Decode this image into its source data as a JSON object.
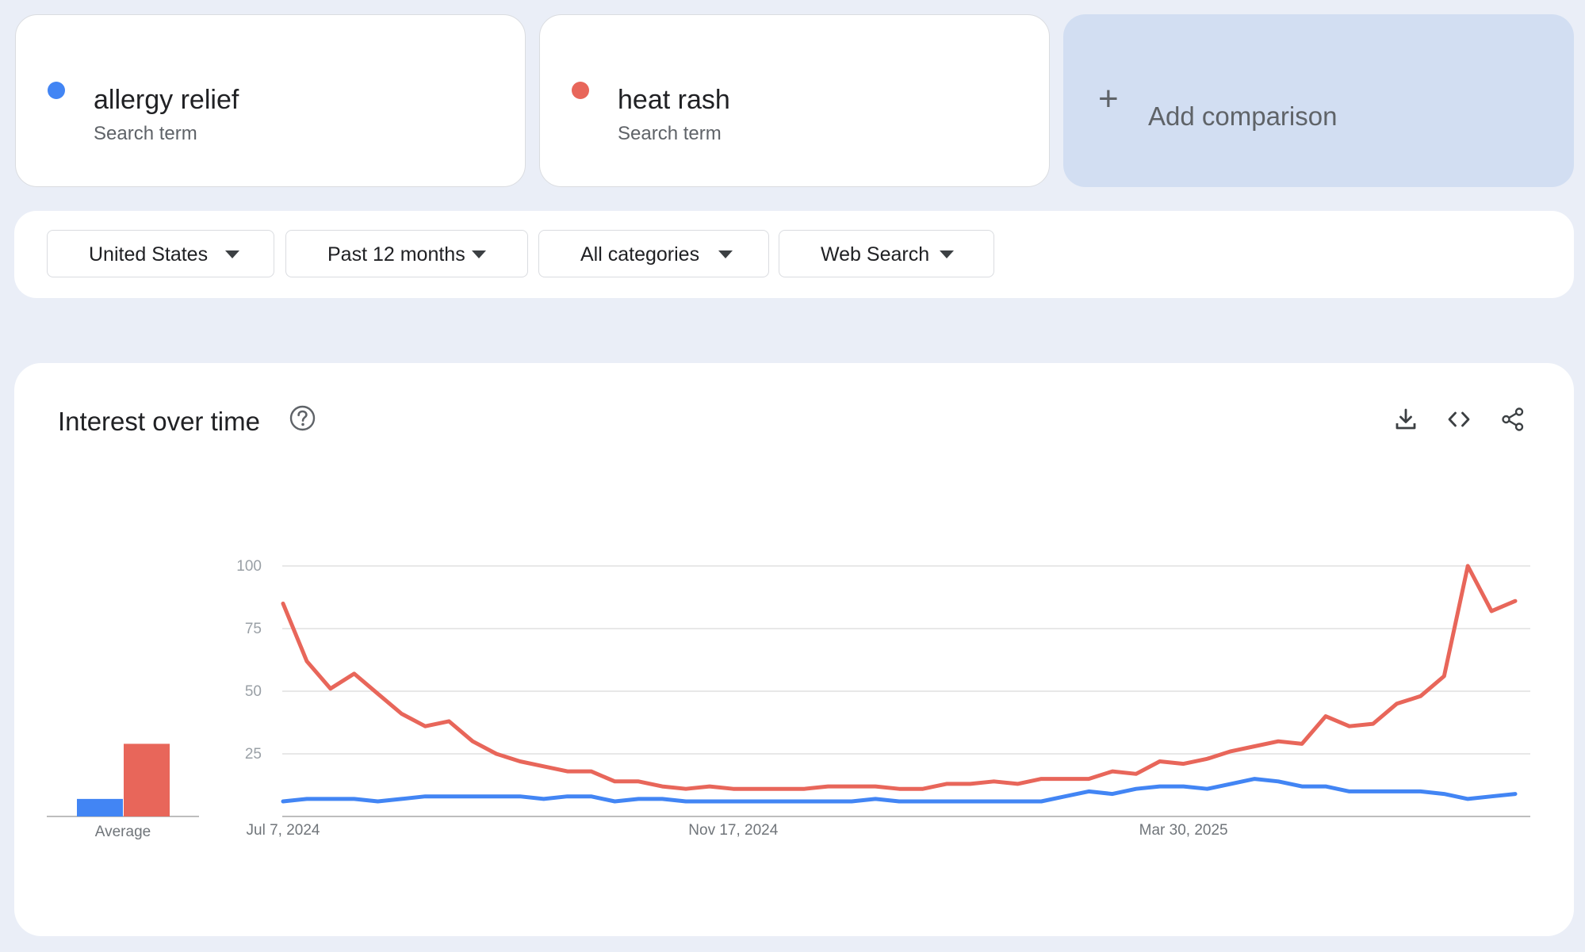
{
  "terms": [
    {
      "name": "allergy relief",
      "type": "Search term",
      "color": "#4285f4"
    },
    {
      "name": "heat rash",
      "type": "Search term",
      "color": "#e8665a"
    }
  ],
  "add_comparison": {
    "icon": "plus-icon",
    "label": "Add comparison"
  },
  "filters": {
    "region": "United States",
    "time_range": "Past 12 months",
    "category": "All categories",
    "search_type": "Web Search"
  },
  "card": {
    "title": "Interest over time",
    "help_icon": "help-circle-icon",
    "tools": [
      "download-icon",
      "embed-code-icon",
      "share-icon"
    ]
  },
  "chart_data": {
    "type": "line",
    "x_tick_labels": [
      "Jul 7, 2024",
      "Nov 17, 2024",
      "Mar 30, 2025"
    ],
    "y_ticks": [
      25,
      50,
      75,
      100
    ],
    "ylim": [
      0,
      100
    ],
    "grid": true,
    "average_label": "Average",
    "series": [
      {
        "name": "allergy relief",
        "color": "#4285f4",
        "average": 7,
        "values": [
          6,
          7,
          7,
          7,
          6,
          7,
          8,
          8,
          8,
          8,
          8,
          7,
          8,
          8,
          6,
          7,
          7,
          6,
          6,
          6,
          6,
          6,
          6,
          6,
          6,
          7,
          6,
          6,
          6,
          6,
          6,
          6,
          6,
          8,
          10,
          9,
          11,
          12,
          12,
          11,
          13,
          15,
          14,
          12,
          12,
          10,
          10,
          10,
          10,
          9,
          7,
          8,
          9
        ]
      },
      {
        "name": "heat rash",
        "color": "#e8665a",
        "average": 29,
        "values": [
          85,
          62,
          51,
          57,
          49,
          41,
          36,
          38,
          30,
          25,
          22,
          20,
          18,
          18,
          14,
          14,
          12,
          11,
          12,
          11,
          11,
          11,
          11,
          12,
          12,
          12,
          11,
          11,
          13,
          13,
          14,
          13,
          15,
          15,
          15,
          18,
          17,
          22,
          21,
          23,
          26,
          28,
          30,
          29,
          40,
          36,
          37,
          45,
          48,
          56,
          100,
          82,
          86
        ]
      }
    ]
  }
}
